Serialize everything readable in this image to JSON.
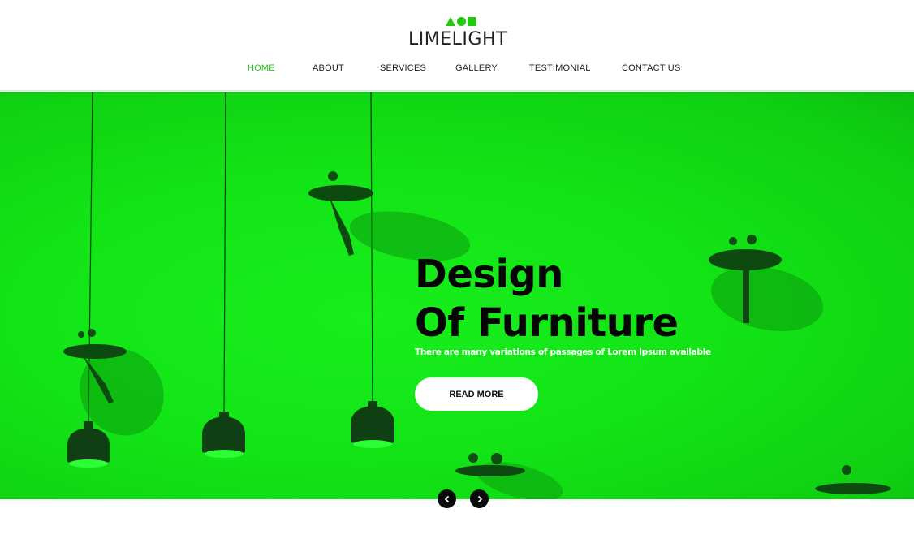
{
  "brand": {
    "logo_text": "LIMELIGHT",
    "logo_icons": [
      "triangle-icon",
      "circle-icon",
      "square-icon"
    ],
    "accent_color": "#22c80f"
  },
  "nav": {
    "items": [
      {
        "label": "HOME",
        "active": true
      },
      {
        "label": "ABOUT",
        "active": false
      },
      {
        "label": "SERVICES",
        "active": false
      },
      {
        "label": "GALLERY",
        "active": false
      },
      {
        "label": "TESTIMONIAL",
        "active": false
      },
      {
        "label": "CONTACT US",
        "active": false
      }
    ]
  },
  "hero": {
    "title_line1": "Design",
    "title_line2": "Of Furniture",
    "subtitle": "There are many variations of passages of Lorem Ipsum available",
    "button_label": "READ MORE",
    "background_color": "#12e416"
  },
  "slider": {
    "prev_icon": "chevron-left-icon",
    "next_icon": "chevron-right-icon"
  }
}
